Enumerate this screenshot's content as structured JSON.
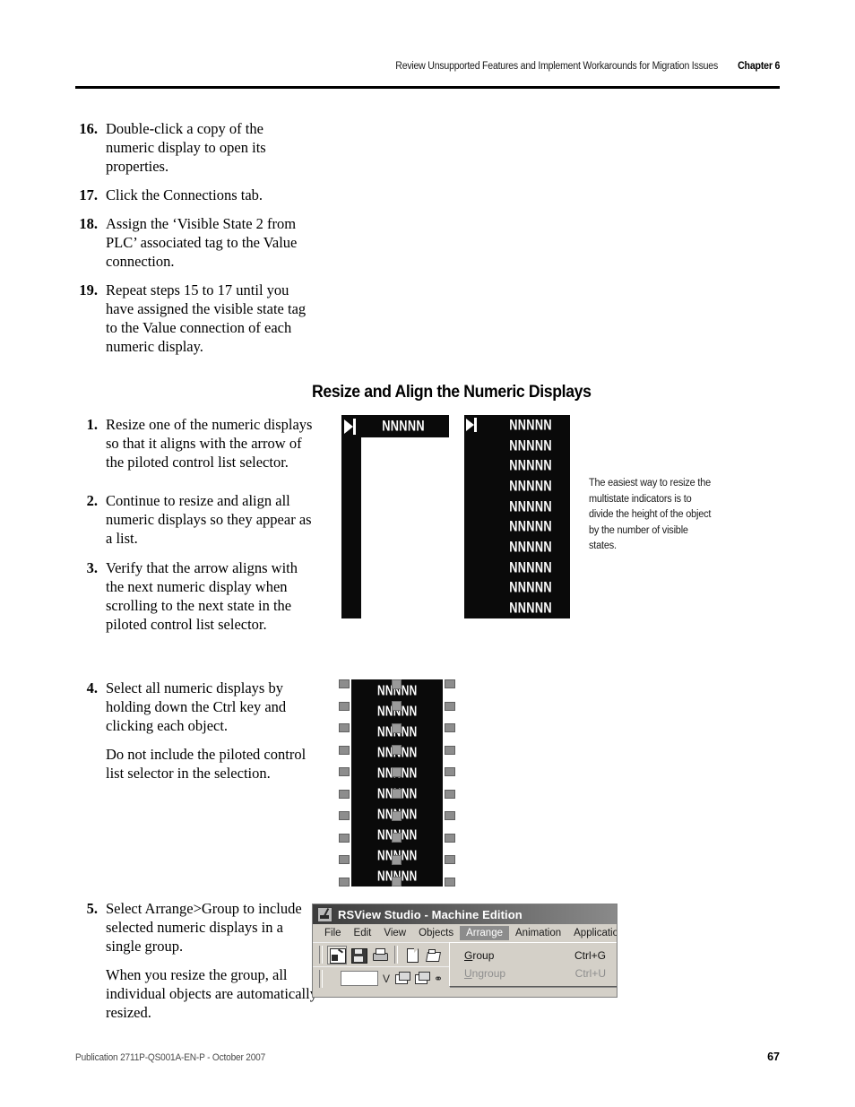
{
  "header": {
    "title": "Review Unsupported Features and Implement Workarounds for Migration Issues",
    "chapter": "Chapter 6"
  },
  "section_heading": "Resize and Align the Numeric Displays",
  "list_one": [
    {
      "marker": "16.",
      "paragraphs": [
        "Double-click a copy of the numeric display to open its properties."
      ]
    },
    {
      "marker": "17.",
      "paragraphs": [
        "Click the Connections tab."
      ]
    },
    {
      "marker": "18.",
      "paragraphs": [
        "Assign the ‘Visible State 2 from PLC’ associated tag to the Value connection."
      ]
    },
    {
      "marker": "19.",
      "paragraphs": [
        "Repeat steps 15 to 17 until you have assigned the visible state tag to the Value connection of each numeric display."
      ]
    }
  ],
  "list_two": [
    {
      "marker": "1.",
      "paragraphs": [
        "Resize one of the numeric displays so that it aligns with the arrow of the piloted control list selector."
      ]
    },
    {
      "marker": "2.",
      "paragraphs": [
        "Continue to resize and align all numeric displays so they appear as a list."
      ]
    },
    {
      "marker": "3.",
      "paragraphs": [
        "Verify that the arrow aligns with the next numeric display when scrolling to the next state in the piloted control list selector."
      ]
    }
  ],
  "list_three": [
    {
      "marker": "4.",
      "paragraphs": [
        "Select all numeric displays by holding down the Ctrl key and clicking each object.",
        "Do not include the piloted control list selector in the selection."
      ]
    }
  ],
  "list_four": [
    {
      "marker": "5.",
      "paragraphs": [
        "Select Arrange>Group to include selected numeric displays in a single group.",
        "When you resize the group, all individual objects are automatically resized."
      ]
    }
  ],
  "figure_one": {
    "numeric_value_text": "NNNNN",
    "single_display_label": "NNNNN",
    "stacked_rows": [
      "NNNNN",
      "NNNNN",
      "NNNNN",
      "NNNNN",
      "NNNNN",
      "NNNNN",
      "NNNNN",
      "NNNNN",
      "NNNNN",
      "NNNNN"
    ],
    "background_color": "#0a0a0a",
    "text_color": "#ffffff"
  },
  "callout": {
    "text": "The easiest way to resize the multistate indicators is to divide the height of the object by the number of visible states."
  },
  "figure_two": {
    "rows": [
      "NNNNN",
      "NNNNN",
      "NNNNN",
      "NNNNN",
      "NNNNN",
      "NNNNN",
      "NNNNN",
      "NNNNN",
      "NNNNN",
      "NNNNN"
    ],
    "handle_count": 10,
    "handle_color": "#8d8d8d",
    "background_color": "#0a0a0a"
  },
  "rsview": {
    "title": "RSView Studio - Machine Edition",
    "title_icon": "rsview-app-icon",
    "menu_items": [
      {
        "label": "File",
        "active": false
      },
      {
        "label": "Edit",
        "active": false
      },
      {
        "label": "View",
        "active": false
      },
      {
        "label": "Objects",
        "active": false
      },
      {
        "label": "Arrange",
        "active": true
      },
      {
        "label": "Animation",
        "active": false
      },
      {
        "label": "Application",
        "active": false
      }
    ],
    "toolbar_icons": [
      "display-icon",
      "save-icon",
      "print-icon",
      "new-icon",
      "open-folder-icon"
    ],
    "toolbar2_glyphs": [
      "V"
    ],
    "dropdown": {
      "items": [
        {
          "label": "Group",
          "label_pre": "G",
          "label_post": "roup",
          "accel": "Ctrl+G",
          "disabled": false
        },
        {
          "label": "Ungroup",
          "label_pre": "U",
          "label_post": "ngroup",
          "accel": "Ctrl+U",
          "disabled": true
        }
      ]
    },
    "titlebar_color": "#3c3c3c",
    "chrome_color": "#d4d0c8",
    "highlight_color": "#8c8c8c"
  },
  "footer": {
    "publication": "Publication 2711P-QS001A-EN-P - October 2007",
    "page_number": "67"
  }
}
